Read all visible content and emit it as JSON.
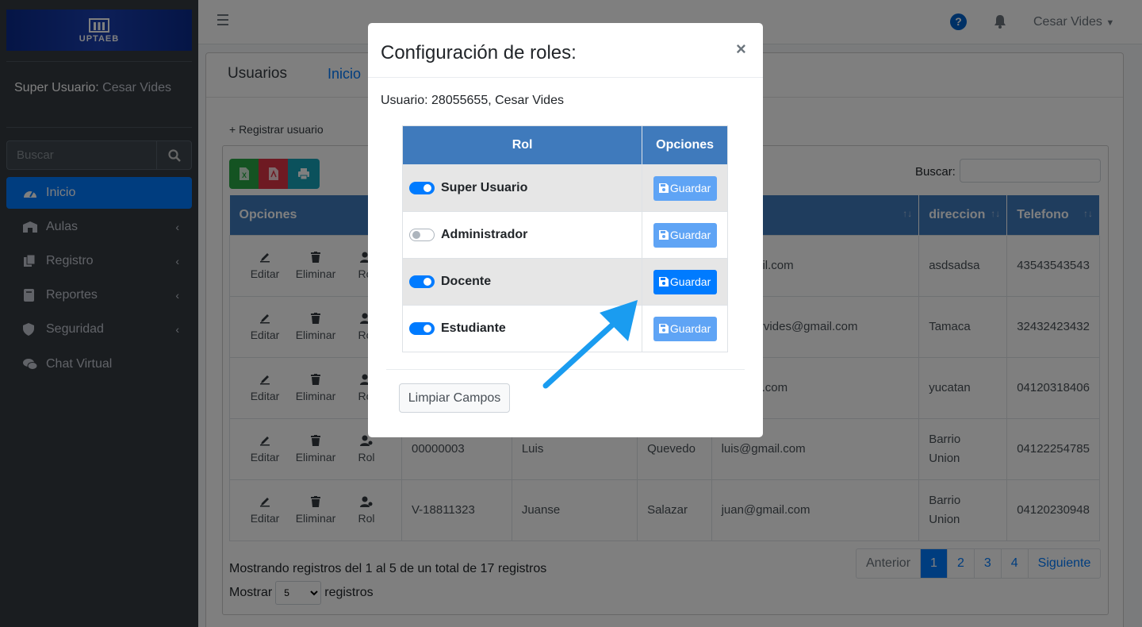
{
  "brand": {
    "logo_text": "UPTAEB"
  },
  "sidebar": {
    "user_label": "Super Usuario:",
    "user_name": "Cesar Vides",
    "search_placeholder": "Buscar",
    "items": [
      {
        "label": "Inicio",
        "icon": "tachometer-icon"
      },
      {
        "label": "Aulas",
        "icon": "building-icon"
      },
      {
        "label": "Registro",
        "icon": "copy-icon"
      },
      {
        "label": "Reportes",
        "icon": "book-icon"
      },
      {
        "label": "Seguridad",
        "icon": "shield-icon"
      },
      {
        "label": "Chat Virtual",
        "icon": "comments-icon"
      }
    ]
  },
  "navbar": {
    "user": "Cesar Vides"
  },
  "page": {
    "title": "Usuarios",
    "breadcrumb": "Inicio",
    "register_link": "+ Registrar usuario",
    "search_label": "Buscar:",
    "columns": [
      "Opciones",
      "",
      "",
      "",
      "o",
      "direccion",
      "Telefono"
    ],
    "actions": [
      "Editar",
      "Eliminar",
      "Rol"
    ],
    "rows": [
      {
        "cedula": "",
        "nombre": "",
        "apellido": "",
        "correo": "s@gmail.com",
        "direccion": "asdsadsa",
        "telefono": "43543543543"
      },
      {
        "cedula": "",
        "nombre": "",
        "apellido": "",
        "correo": "sdsadarvides@gmail.com",
        "direccion": "Tamaca",
        "telefono": "32432423432"
      },
      {
        "cedula": "",
        "nombre": "",
        "apellido": "",
        "correo": "@gmail.com",
        "direccion": "yucatan",
        "telefono": "04120318406"
      },
      {
        "cedula": "00000003",
        "nombre": "Luis",
        "apellido": "Quevedo",
        "correo": "luis@gmail.com",
        "direccion": "Barrio Union",
        "telefono": "04122254785"
      },
      {
        "cedula": "V-18811323",
        "nombre": "Juanse",
        "apellido": "Salazar",
        "correo": "juan@gmail.com",
        "direccion": "Barrio Union",
        "telefono": "04120230948"
      }
    ],
    "info": "Mostrando registros del 1 al 5 de un total de 17 registros",
    "show_prefix": "Mostrar",
    "show_value": "5",
    "show_suffix": "registros",
    "pager": {
      "prev": "Anterior",
      "pages": [
        "1",
        "2",
        "3",
        "4"
      ],
      "next": "Siguiente"
    }
  },
  "modal": {
    "title": "Configuración de roles:",
    "close": "×",
    "user_line": "Usuario: 28055655, Cesar Vides",
    "col_role": "Rol",
    "col_options": "Opciones",
    "save_label": "Guardar",
    "roles": [
      {
        "name": "Super Usuario",
        "enabled": true
      },
      {
        "name": "Administrador",
        "enabled": false
      },
      {
        "name": "Docente",
        "enabled": true
      },
      {
        "name": "Estudiante",
        "enabled": true
      }
    ],
    "clear_button": "Limpiar Campos"
  },
  "colors": {
    "primary": "#007bff",
    "header_blue": "#3f7abc",
    "sidebar": "#343a40",
    "arrow": "#1a9cf0"
  }
}
